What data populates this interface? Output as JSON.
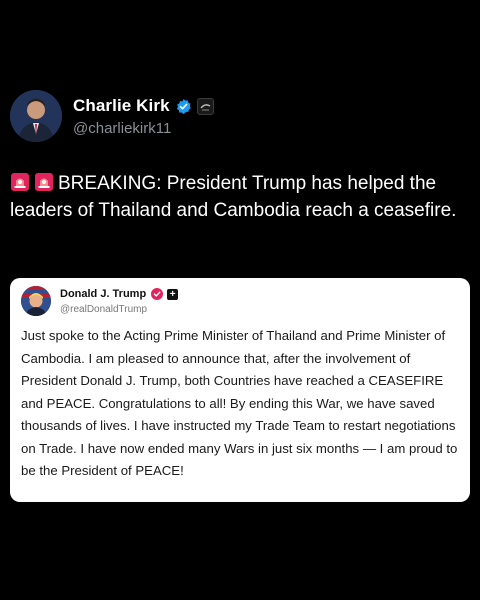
{
  "post": {
    "author": {
      "name": "Charlie Kirk",
      "handle": "@charliekirk11",
      "verified_color": "#1d9bf0",
      "affiliation_icon": "affiliate-badge-icon"
    },
    "text": "BREAKING: President Trump has helped the leaders of Thailand and Cambodia reach a ceasefire.",
    "leading_icons": [
      "siren-icon",
      "siren-icon"
    ]
  },
  "quote": {
    "author": {
      "name": "Donald J. Trump",
      "handle": "@realDonaldTrump",
      "badge_color": "#e0245e"
    },
    "text": "Just spoke to the Acting Prime Minister of Thailand and Prime Minister of Cambodia. I am pleased to announce that, after the involvement of President Donald J. Trump, both Countries have reached a CEASEFIRE and PEACE. Congratulations to all! By ending this War, we have saved thousands of lives. I have instructed my Trade Team to restart negotiations on Trade. I have now ended many Wars in just six months — I am proud to be the President of PEACE!"
  },
  "colors": {
    "background": "#000000",
    "primary_text": "#ffffff",
    "secondary_text": "#8b8f95",
    "card_background": "#ffffff"
  }
}
